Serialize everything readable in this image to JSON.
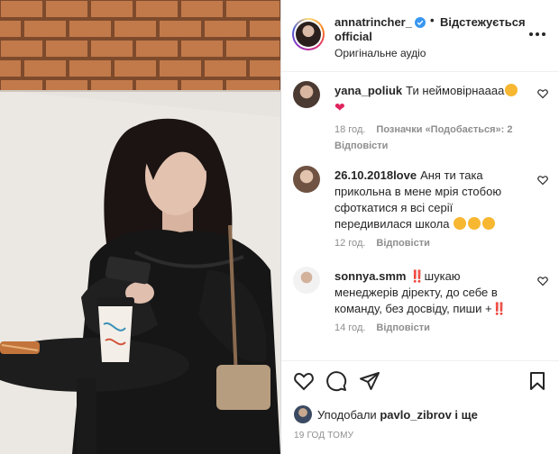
{
  "post": {
    "username": "annatrincher_ official",
    "separator": "•",
    "follow_label": "Відстежується",
    "audio_label": "Оригінальне аудіо"
  },
  "comments": [
    {
      "user": "yana_poliuk",
      "text": "Ти неймовірнаааа",
      "emoji": [
        "star-struck-emoji",
        "red-heart-emoji"
      ],
      "time": "18 год.",
      "likes": "Позначки «Подобається»: 2",
      "reply": "Відповісти"
    },
    {
      "user": "26.10.2018love",
      "text": "Аня ти така прикольна в мене мрія стобою сфоткатися я всі серії передивилася школа",
      "emoji": [
        "kissing-emoji",
        "kissing-emoji",
        "kissing-emoji"
      ],
      "time": "12 год.",
      "reply": "Відповісти"
    },
    {
      "user": "sonnya.smm",
      "text": "‼️шукаю менеджерів діректу, до себе в команду, без досвіду, пиши +‼️",
      "time": "14 год.",
      "reply": "Відповісти"
    }
  ],
  "likes": {
    "prefix": "Уподобали",
    "user": "pavlo_zibrov",
    "suffix": "і ще"
  },
  "timestamp": "19 ГОД ТОМУ",
  "colors": {
    "accent_verified": "#3897f0",
    "heart": "#e0245e",
    "muted": "#8e8e8e"
  }
}
